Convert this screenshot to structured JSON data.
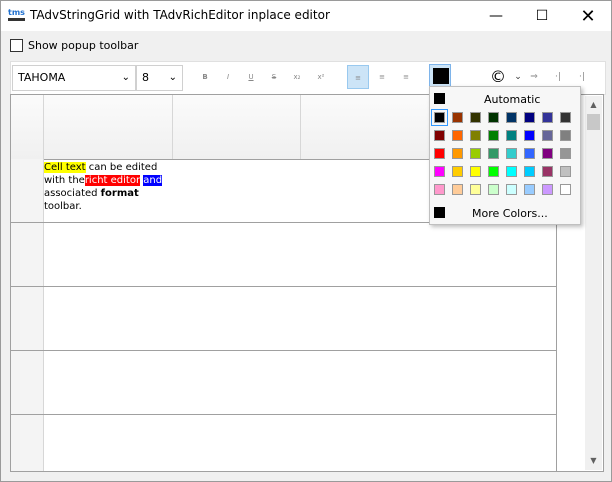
{
  "window": {
    "app_icon": "tms",
    "title": "TAdvStringGrid with TAdvRichEditor inplace editor"
  },
  "options": {
    "show_popup_toolbar": "Show popup toolbar",
    "checked": false
  },
  "toolbar": {
    "font_name": "TAHOMA",
    "font_size": "8",
    "buttons": [
      "B",
      "I",
      "U",
      "S",
      "x₂",
      "x²",
      "≡",
      "≡",
      "≡"
    ],
    "color_icon": "copyright-icon",
    "color_value": "#000000"
  },
  "grid": {
    "cell_text": {
      "p1": "Cell text",
      "p2": " can be edited with the",
      "p3": "richt editor",
      "p4": " ",
      "p5": "and",
      "p6": " associated ",
      "p7": "format",
      "p8": " toolbar."
    }
  },
  "color_popup": {
    "automatic_label": "Automatic",
    "more_colors_label": "More Colors...",
    "rows": [
      [
        "#000000",
        "#993300",
        "#333300",
        "#003300",
        "#003366",
        "#000080",
        "#333399",
        "#333333"
      ],
      [
        "#800000",
        "#ff6600",
        "#808000",
        "#008000",
        "#008080",
        "#0000ff",
        "#666699",
        "#808080"
      ],
      [
        "#ff0000",
        "#ff9900",
        "#99cc00",
        "#339966",
        "#33cccc",
        "#3366ff",
        "#800080",
        "#969696"
      ],
      [
        "#ff00ff",
        "#ffcc00",
        "#ffff00",
        "#00ff00",
        "#00ffff",
        "#00ccff",
        "#993366",
        "#c0c0c0"
      ],
      [
        "#ff99cc",
        "#ffcc99",
        "#ffff99",
        "#ccffcc",
        "#ccffff",
        "#99ccff",
        "#cc99ff",
        "#ffffff"
      ]
    ]
  }
}
